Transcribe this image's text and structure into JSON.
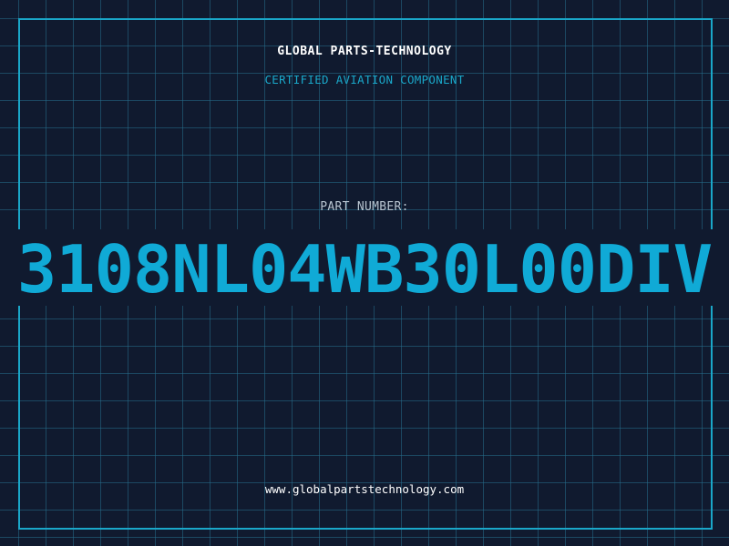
{
  "header": {
    "brand": "GLOBAL PARTS-TECHNOLOGY",
    "subtitle": "CERTIFIED AVIATION COMPONENT"
  },
  "part": {
    "label": "PART NUMBER:",
    "number": "3108NL04WB30L00DIV"
  },
  "footer": {
    "website": "www.globalpartstechnology.com"
  },
  "colors": {
    "background": "#101a2f",
    "accent": "#1aa7c9",
    "part_number": "#10aad6",
    "text": "#ffffff",
    "label": "#b8c4d0"
  }
}
